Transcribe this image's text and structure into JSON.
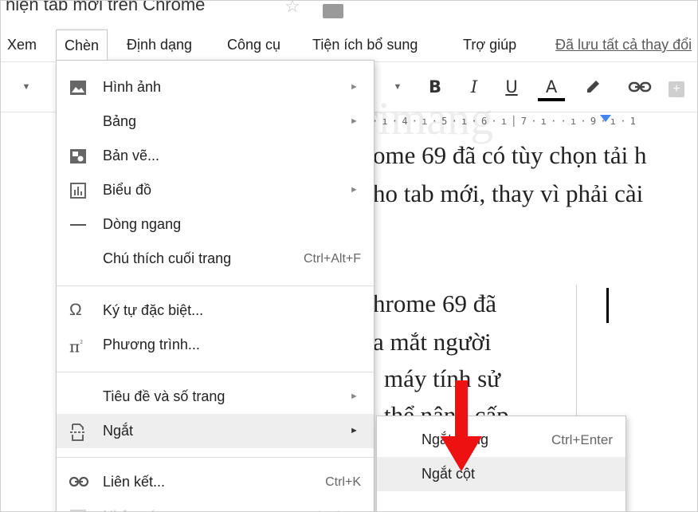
{
  "doc_title": "hiện tab mới trên Chrome",
  "menubar": {
    "items": [
      "Xem",
      "Chèn",
      "Định dạng",
      "Công cụ",
      "Tiện ích bổ sung",
      "Trợ giúp"
    ],
    "saved_status": "Đã lưu tất cả thay đổi"
  },
  "toolbar": {
    "bold": "B",
    "italic": "I",
    "underline": "U",
    "text_color": "A",
    "text_color_value": "#000000"
  },
  "ruler": {
    "text": "· ı · 4 · ı · 5 · ı · 6 · ı │ 7 · ı · · ı · 9 · ı · 1"
  },
  "watermark": "uantrimang",
  "document": {
    "lines": [
      "ome 69 đã có tùy chọn tải h",
      "ho tab mới, thay vì phải cài",
      "hrome 69 đã",
      "a mắt người",
      "máy tính sử",
      "thể nâng cấp"
    ]
  },
  "insert_menu": {
    "items": [
      {
        "label": "Hình ảnh",
        "icon": "image-icon",
        "has_submenu": true
      },
      {
        "label": "Bảng",
        "icon": "",
        "has_submenu": true
      },
      {
        "label": "Bản vẽ...",
        "icon": "drawing-icon",
        "has_submenu": false
      },
      {
        "label": "Biểu đồ",
        "icon": "chart-icon",
        "has_submenu": true
      },
      {
        "label": "Dòng ngang",
        "icon": "horizontal-line-icon",
        "has_submenu": false
      },
      {
        "label": "Chú thích cuối trang",
        "shortcut": "Ctrl+Alt+F"
      },
      {
        "label": "Ký tự đặc biệt...",
        "icon": "omega-icon"
      },
      {
        "label": "Phương trình...",
        "icon": "pi-icon"
      },
      {
        "label": "Tiêu đề và số trang",
        "has_submenu": true
      },
      {
        "label": "Ngắt",
        "icon": "page-break-icon",
        "has_submenu": true,
        "highlighted": true
      },
      {
        "label": "Liên kết...",
        "icon": "link-icon",
        "shortcut": "Ctrl+K"
      },
      {
        "label": "Nhận xét",
        "shortcut": "Ctrl+Alt+M",
        "disabled": true
      }
    ]
  },
  "break_submenu": {
    "items": [
      {
        "label": "Ngắt trang",
        "shortcut": "Ctrl+Enter"
      },
      {
        "label": "Ngắt cột",
        "highlighted": true
      }
    ]
  },
  "colors": {
    "arrow": "#ee1111",
    "menu_highlight": "#eeeeee",
    "ruler_marker": "#4285f4"
  }
}
